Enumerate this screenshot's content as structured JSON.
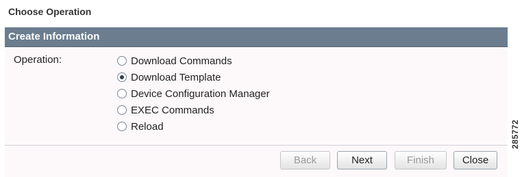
{
  "page_title": "Choose Operation",
  "panel": {
    "header": "Create Information",
    "operation_label": "Operation:",
    "options": [
      {
        "label": "Download Commands",
        "checked": false
      },
      {
        "label": "Download Template",
        "checked": true
      },
      {
        "label": "Device Configuration Manager",
        "checked": false
      },
      {
        "label": "EXEC Commands",
        "checked": false
      },
      {
        "label": "Reload",
        "checked": false
      }
    ]
  },
  "buttons": {
    "back": "Back",
    "next": "Next",
    "finish": "Finish",
    "close": "Close"
  },
  "side_tag": "285772"
}
